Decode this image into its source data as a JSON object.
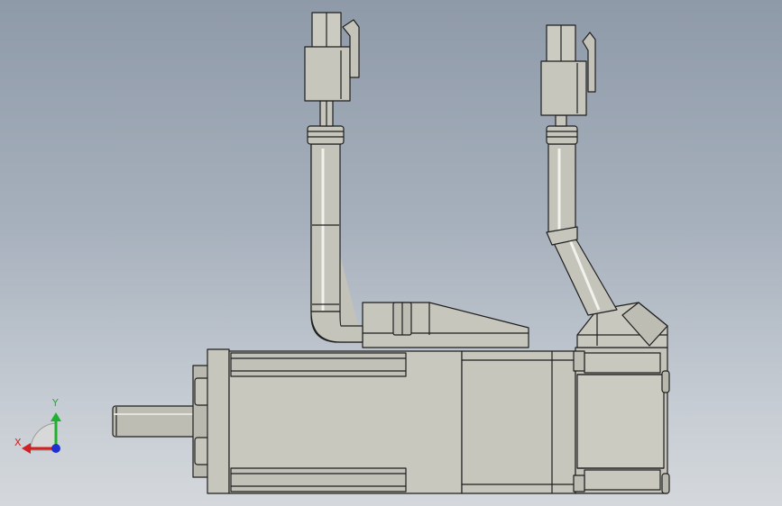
{
  "viewport": {
    "background_top": "#8f9aa9",
    "background_bottom": "#d4d8dc"
  },
  "model": {
    "part_color": "#c6c6bd",
    "edge_color": "#1e1e1e"
  },
  "triad": {
    "x_label": "X",
    "y_label": "Y",
    "x_color": "#d42020",
    "y_color": "#20b030",
    "z_color": "#2030d0"
  }
}
